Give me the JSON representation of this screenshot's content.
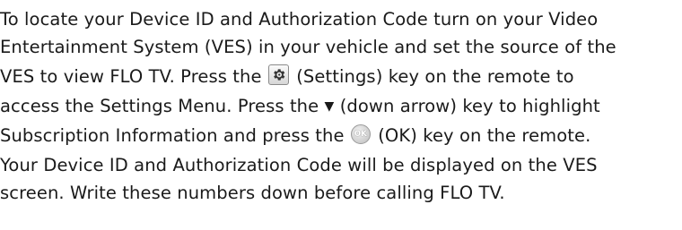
{
  "paragraph": {
    "line1": "To locate your Device ID and Authorization Code turn on your Video",
    "line2": "Entertainment System (VES) in your vehicle and set the source of the",
    "line3_pre": "VES to view FLO TV.  Press the ",
    "line3_post": " (Settings) key on the remote to",
    "line4_pre": "access the Settings Menu. Press the ",
    "down_arrow": "▼",
    "line4_post": " (down arrow) key to highlight",
    "line5_pre": "Subscription Information and press the ",
    "ok_label": "OK",
    "line5_post": " (OK) key on the remote.",
    "line6": "Your Device ID and Authorization Code will be displayed on the VES",
    "line7": "screen.  Write these numbers down before calling FLO TV."
  },
  "icons": {
    "settings_key": "gear-icon",
    "ok_key": "ok-button-icon"
  }
}
